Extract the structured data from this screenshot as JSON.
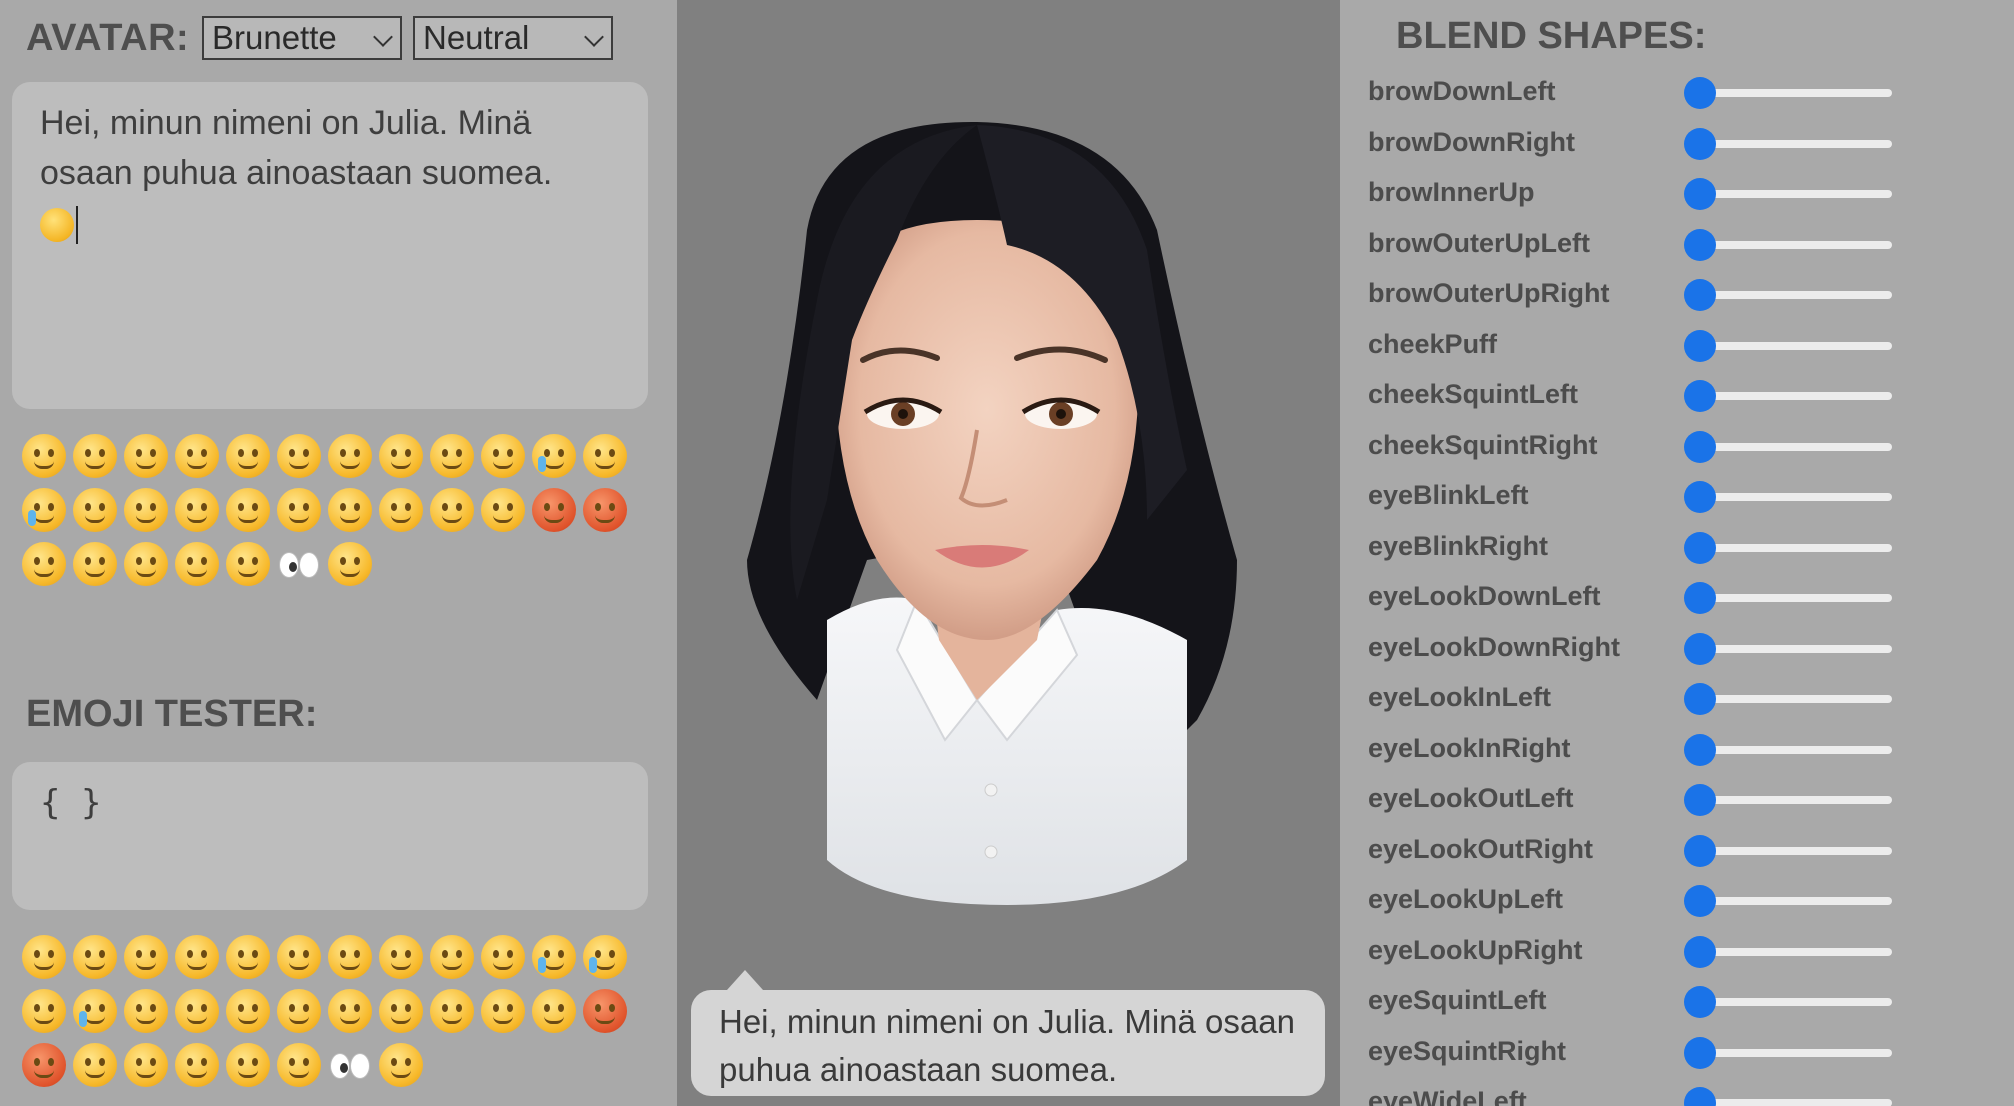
{
  "avatar_section": {
    "label": "AVATAR:",
    "skin_select": {
      "value": "Brunette"
    },
    "mood_select": {
      "value": "Neutral"
    }
  },
  "main_textbox": {
    "text": "Hei, minun nimeni on Julia. Minä osaan puhua ainoastaan suomea."
  },
  "emoji_palette_1": [
    "neutral",
    "smirk",
    "slight-smile",
    "blush",
    "grin",
    "smiley",
    "smile",
    "beaming",
    "laughing",
    "tongue-squint",
    "joy",
    "wink",
    "sob",
    "pleading",
    "disappointed",
    "pensive",
    "unamused",
    "flushed",
    "kissing-closed-eyes",
    "kissing-heart",
    "smiling-hearts",
    "heart-eyes",
    "rage",
    "angry",
    "frowning",
    "scream",
    "grimacing",
    "rolling-eyes",
    "thinking",
    "eyes",
    "sleepy"
  ],
  "emoji_tester": {
    "title": "EMOJI TESTER:",
    "json_text": "{ }"
  },
  "emoji_palette_2": [
    "neutral",
    "smirk",
    "slight-smile",
    "blush",
    "grin",
    "smiley",
    "smile",
    "beaming",
    "laughing",
    "tongue-squint",
    "joy",
    "rofl",
    "wink",
    "sob",
    "pleading",
    "disappointed",
    "pensive",
    "unamused",
    "flushed",
    "kissing-closed-eyes",
    "kissing-heart",
    "smiling-hearts",
    "heart-eyes",
    "rage",
    "angry",
    "frowning",
    "scream",
    "grimacing",
    "rolling-eyes",
    "thinking",
    "eyes",
    "sleepy"
  ],
  "speech_bubble": {
    "text": "Hei, minun nimeni on Julia. Minä osaan puhua ainoastaan suomea."
  },
  "blend_shapes": {
    "title": "BLEND SHAPES:",
    "items": [
      {
        "label": "browDownLeft",
        "value": 0
      },
      {
        "label": "browDownRight",
        "value": 0
      },
      {
        "label": "browInnerUp",
        "value": 0
      },
      {
        "label": "browOuterUpLeft",
        "value": 0
      },
      {
        "label": "browOuterUpRight",
        "value": 0
      },
      {
        "label": "cheekPuff",
        "value": 0
      },
      {
        "label": "cheekSquintLeft",
        "value": 0
      },
      {
        "label": "cheekSquintRight",
        "value": 0
      },
      {
        "label": "eyeBlinkLeft",
        "value": 0
      },
      {
        "label": "eyeBlinkRight",
        "value": 0
      },
      {
        "label": "eyeLookDownLeft",
        "value": 0
      },
      {
        "label": "eyeLookDownRight",
        "value": 0
      },
      {
        "label": "eyeLookInLeft",
        "value": 0
      },
      {
        "label": "eyeLookInRight",
        "value": 0
      },
      {
        "label": "eyeLookOutLeft",
        "value": 0
      },
      {
        "label": "eyeLookOutRight",
        "value": 0
      },
      {
        "label": "eyeLookUpLeft",
        "value": 0
      },
      {
        "label": "eyeLookUpRight",
        "value": 0
      },
      {
        "label": "eyeSquintLeft",
        "value": 0
      },
      {
        "label": "eyeSquintRight",
        "value": 0
      },
      {
        "label": "eyeWideLeft",
        "value": 0
      }
    ]
  },
  "colors": {
    "panel_bg": "#a9a9a9",
    "stage_bg": "#808080",
    "slider_thumb": "#1a73e8",
    "heading_text": "#4e4e4e"
  }
}
